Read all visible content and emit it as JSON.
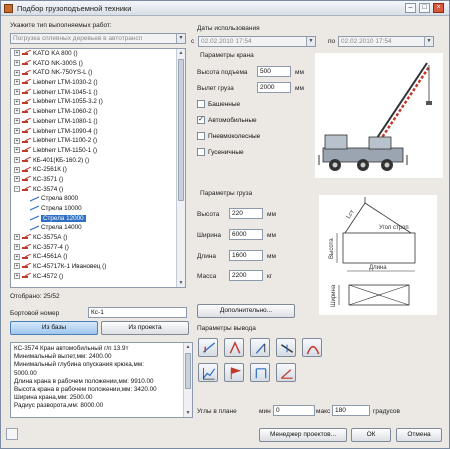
{
  "window": {
    "title": "Подбор грузоподъемной техники",
    "minimize": "–",
    "maximize": "□",
    "close": "×"
  },
  "left": {
    "work_type_label": "Укажите тип выполняемых работ:",
    "work_type_value": "Погрузка сплевных деревьев в автотрансп",
    "tree": [
      {
        "label": "KATO KA 800 ()",
        "level": 0,
        "expanded": false
      },
      {
        "label": "KATO NK-300S ()",
        "level": 0,
        "expanded": false
      },
      {
        "label": "KATO NK-750YS-L ()",
        "level": 0,
        "expanded": false
      },
      {
        "label": "Liebherr LTM-1030-2 ()",
        "level": 0,
        "expanded": false
      },
      {
        "label": "Liebherr LTM-1045-1 ()",
        "level": 0,
        "expanded": false
      },
      {
        "label": "Liebherr LTM-1055-3.2 ()",
        "level": 0,
        "expanded": false
      },
      {
        "label": "Liebherr LTM-1060-2 ()",
        "level": 0,
        "expanded": false
      },
      {
        "label": "Liebherr LTM-1080-1 ()",
        "level": 0,
        "expanded": false
      },
      {
        "label": "Liebherr LTM-1090-4 ()",
        "level": 0,
        "expanded": false
      },
      {
        "label": "Liebherr LTM-1100-2 ()",
        "level": 0,
        "expanded": false
      },
      {
        "label": "Liebherr LTM-1150-1 ()",
        "level": 0,
        "expanded": false
      },
      {
        "label": "КБ-401(КБ-160.2) ()",
        "level": 0,
        "expanded": false
      },
      {
        "label": "КС-2561К ()",
        "level": 0,
        "expanded": false
      },
      {
        "label": "КС-3571 ()",
        "level": 0,
        "expanded": false
      },
      {
        "label": "КС-3574 ()",
        "level": 0,
        "expanded": true
      },
      {
        "label": "Стрела 8000",
        "level": 1,
        "expanded": false
      },
      {
        "label": "Стрела 10000",
        "level": 1,
        "expanded": false
      },
      {
        "label": "Стрела 12000",
        "level": 1,
        "expanded": false,
        "selected": true
      },
      {
        "label": "Стрела 14000",
        "level": 1,
        "expanded": false
      },
      {
        "label": "КС-3575А ()",
        "level": 0,
        "expanded": false
      },
      {
        "label": "КС-3577-4 ()",
        "level": 0,
        "expanded": false
      },
      {
        "label": "КС-4561А ()",
        "level": 0,
        "expanded": false
      },
      {
        "label": "КС-45717К-1 Ивановец ()",
        "level": 0,
        "expanded": false
      },
      {
        "label": "КС-4572 ()",
        "level": 0,
        "expanded": false
      }
    ],
    "selected_count": "Отобрано: 25/52",
    "board_number_label": "Бортовой номер",
    "board_number_value": "Кс-1",
    "from_db_button": "Из базы",
    "from_project_button": "Из проекта",
    "info_lines": [
      "КС-3574 Кран автомобильный г/п 13.9т",
      "Минимальный вылет,мм: 2400.00",
      "Минимальный глубина опускания крюка,мм:",
      "5000.00",
      "Длина крана в рабочем положении,мм: 9910.00",
      "Высота крана в рабочем положении,мм: 3420.00",
      "Ширина крана,мм: 2500.00",
      "Радиус разворота,мм: 8000.00"
    ]
  },
  "dates": {
    "label": "Даты использования",
    "from_label": "с",
    "from_value": "02.02.2010 17:54",
    "to_label": "по",
    "to_value": "02.02.2010 17:54"
  },
  "crane_params": {
    "title": "Параметры крана",
    "lift_height_label": "Высота подъема",
    "lift_height_value": "500",
    "reach_label": "Вылет груза",
    "reach_value": "2000",
    "unit": "мм",
    "types": [
      {
        "label": "Башенные",
        "checked": false
      },
      {
        "label": "Автомобильные",
        "checked": true
      },
      {
        "label": "Пневмоколесные",
        "checked": false
      },
      {
        "label": "Гусеничные",
        "checked": false
      }
    ]
  },
  "cargo_params": {
    "title": "Параметры груза",
    "height_label": "Высота",
    "height_value": "220",
    "width_label": "Ширина",
    "width_value": "6000",
    "length_label": "Длина",
    "length_value": "1600",
    "mass_label": "Масса",
    "mass_value": "2200",
    "unit_mm": "мм",
    "unit_kg": "кг",
    "additional_button": "Дополнительно...",
    "diagram": {
      "len_label": "Lст",
      "slope_label": "Угол строп",
      "height_label": "Высота",
      "length_label": "Длина",
      "width_label": "Ширина"
    }
  },
  "output_params": {
    "title": "Параметры вывода",
    "tools": [
      "crane-profile-icon",
      "crane-hook-icon",
      "crane-lift-icon",
      "boom-icon",
      "arch-icon",
      "chart-icon",
      "flag-icon",
      "rope-icon",
      "angle-icon"
    ],
    "angles_label": "Углы в плане",
    "min_label": "мин",
    "min_value": "0",
    "max_label": "макс",
    "max_value": "180",
    "degrees_label": "градусов"
  },
  "footer": {
    "manager_button": "Менеджер проектов...",
    "ok_button": "ОК",
    "cancel_button": "Отмена"
  },
  "colors": {
    "accent": "#2f6fc4",
    "title_bar": "#d9dee6",
    "window_bg": "#ece9e4"
  }
}
